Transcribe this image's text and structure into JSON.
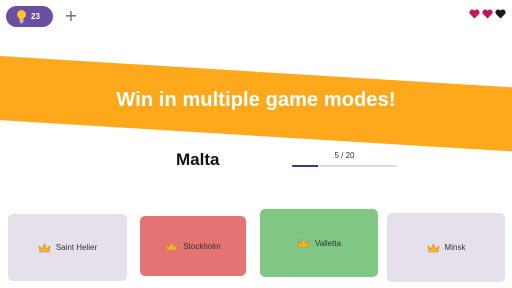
{
  "header": {
    "hint_count": "23",
    "hint_icon": "lightbulb-icon",
    "add_symbol": "+",
    "lives": {
      "total": 3,
      "colors": [
        "#c2185b",
        "#c2185b",
        "#1a1a1a"
      ]
    }
  },
  "banner": {
    "text": "Win in multiple game modes!",
    "color": "#fea91c"
  },
  "question": {
    "country": "Malta",
    "progress_text": "5 / 20",
    "progress_fraction": 0.25
  },
  "options": [
    {
      "label": "Saint Helier",
      "state": "neutral",
      "color": "#e6e0ec",
      "icon": "crown-icon"
    },
    {
      "label": "Stockholm",
      "state": "wrong",
      "color": "#e57373",
      "icon": "crown-icon"
    },
    {
      "label": "Valletta",
      "state": "correct",
      "color": "#81c784",
      "icon": "crown-icon"
    },
    {
      "label": "Minsk",
      "state": "neutral",
      "color": "#e6e0ec",
      "icon": "crown-icon"
    }
  ]
}
